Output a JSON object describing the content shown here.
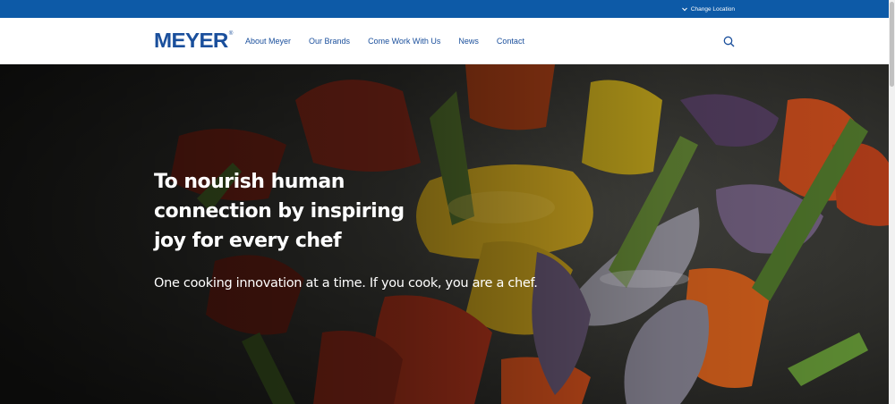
{
  "topbar": {
    "location_label": "Change Location",
    "icon": "chevron-down-icon"
  },
  "header": {
    "logo_text": "MEYER",
    "logo_mark": "®",
    "nav": [
      {
        "label": "About Meyer"
      },
      {
        "label": "Our Brands"
      },
      {
        "label": "Come Work With Us"
      },
      {
        "label": "News"
      },
      {
        "label": "Contact"
      }
    ],
    "search_icon": "search-icon"
  },
  "hero": {
    "headline": "To nourish human connection by inspiring joy for every chef",
    "subheadline": "One cooking innovation at a time. If you cook, you are a chef."
  },
  "colors": {
    "brand_blue": "#0d5aa7",
    "logo_blue": "#1a4f9c"
  }
}
